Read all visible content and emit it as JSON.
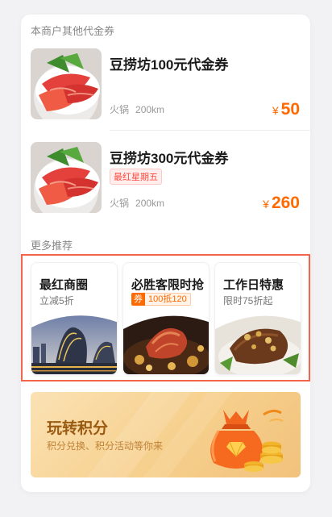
{
  "section_other_vouchers": "本商户其他代金券",
  "vouchers": [
    {
      "name": "豆捞坊100元代金券",
      "tag": "",
      "category": "火锅",
      "distance": "200km",
      "currency": "¥",
      "price": "50"
    },
    {
      "name": "豆捞坊300元代金券",
      "tag": "最红星期五",
      "category": "火锅",
      "distance": "200km",
      "currency": "¥",
      "price": "260"
    }
  ],
  "section_more": "更多推荐",
  "recommendations": [
    {
      "title": "最红商圈",
      "subtitle": "立减5折"
    },
    {
      "title": "必胜客限时抢",
      "badge_icon": "券",
      "badge_text": "100抵120"
    },
    {
      "title": "工作日特惠",
      "subtitle": "限时75折起"
    }
  ],
  "points": {
    "title": "玩转积分",
    "subtitle": "积分兑换、积分活动等你来"
  },
  "colors": {
    "price": "#ff6a00",
    "highlight_border": "#f3654a",
    "tag_red": "#ff4a3d"
  }
}
